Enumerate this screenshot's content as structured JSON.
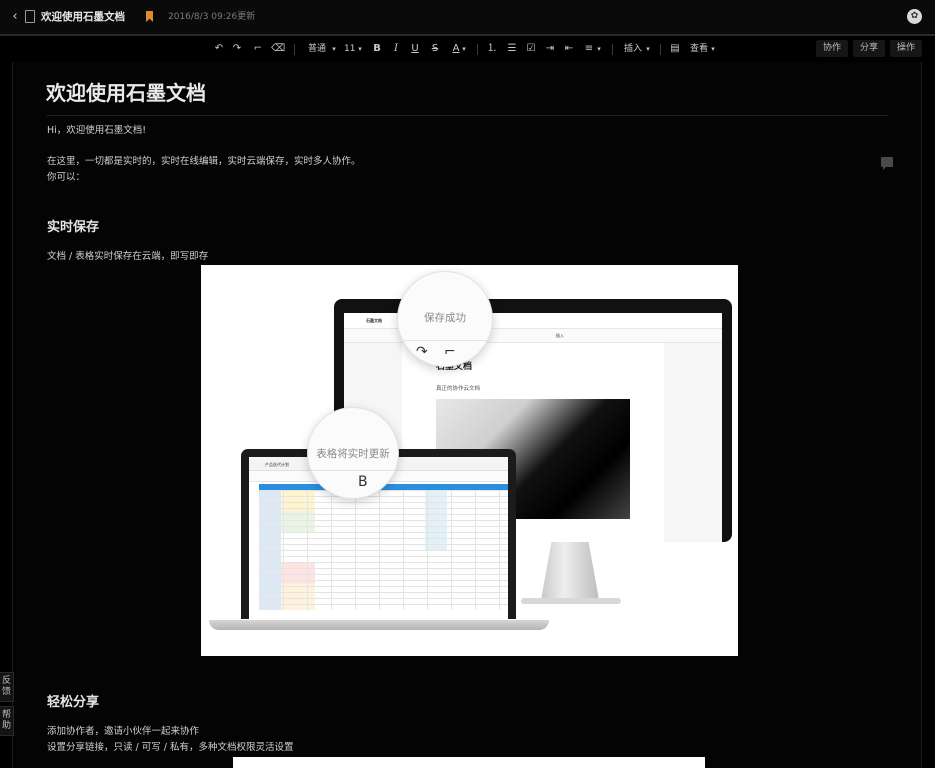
{
  "titlebar": {
    "back": "‹",
    "title": "欢迎使用石墨文档",
    "caret": "▾",
    "timestamp": "2016/8/3 09:26更新",
    "avatar": "✿"
  },
  "toolbar": {
    "undo": "↶",
    "redo": "↷",
    "format_paint": "⌐",
    "clear_format": "⌫",
    "style": "普通",
    "style_caret": "▾",
    "font_size": "11",
    "font_size_caret": "▾",
    "bold": "B",
    "italic": "I",
    "underline": "U",
    "strike": "S",
    "font_color": "A",
    "font_color_caret": "▾",
    "ordered_list": "⒈",
    "bullet_list": "☰",
    "checklist": "☑",
    "indent": "⇥",
    "outdent": "⇤",
    "align": "≡",
    "align_caret": "▾",
    "insert": "插入",
    "insert_caret": "▾",
    "comment": "▤",
    "view": "查看",
    "view_caret": "▾",
    "collaborate": "协作",
    "share": "分享",
    "actions": "操作"
  },
  "document": {
    "title": "欢迎使用石墨文档",
    "p1": "Hi，欢迎使用石墨文档!",
    "p2": "在这里，一切都是实时的，实时在线编辑，实时云端保存，实时多人协作。",
    "p3": "你可以：",
    "h_save": "实时保存",
    "p_save": "文档 / 表格实时保存在云端，即写即存",
    "h_share": "轻松分享",
    "p_share1": "添加协作者，邀请小伙伴一起来协作",
    "p_share2": "设置分享链接，只读 / 可写 / 私有，多种文档权限灵活设置"
  },
  "hero": {
    "monitor_title": "石墨文档",
    "monitor_sub": "真正的协作云文档",
    "monitor_tab": "石墨文档",
    "monitor_insert": "插入",
    "laptop_tab": "产品迭代计划",
    "mag_top_label": "保存成功",
    "mag_bottom_label": "表格将实时更新",
    "mag_bottom_glyph": "B"
  },
  "side": {
    "feedback": "反馈",
    "help": "帮助"
  },
  "colors": {
    "accent_bookmark": "#e0892e",
    "sheet_header": "#2b8fe0"
  }
}
